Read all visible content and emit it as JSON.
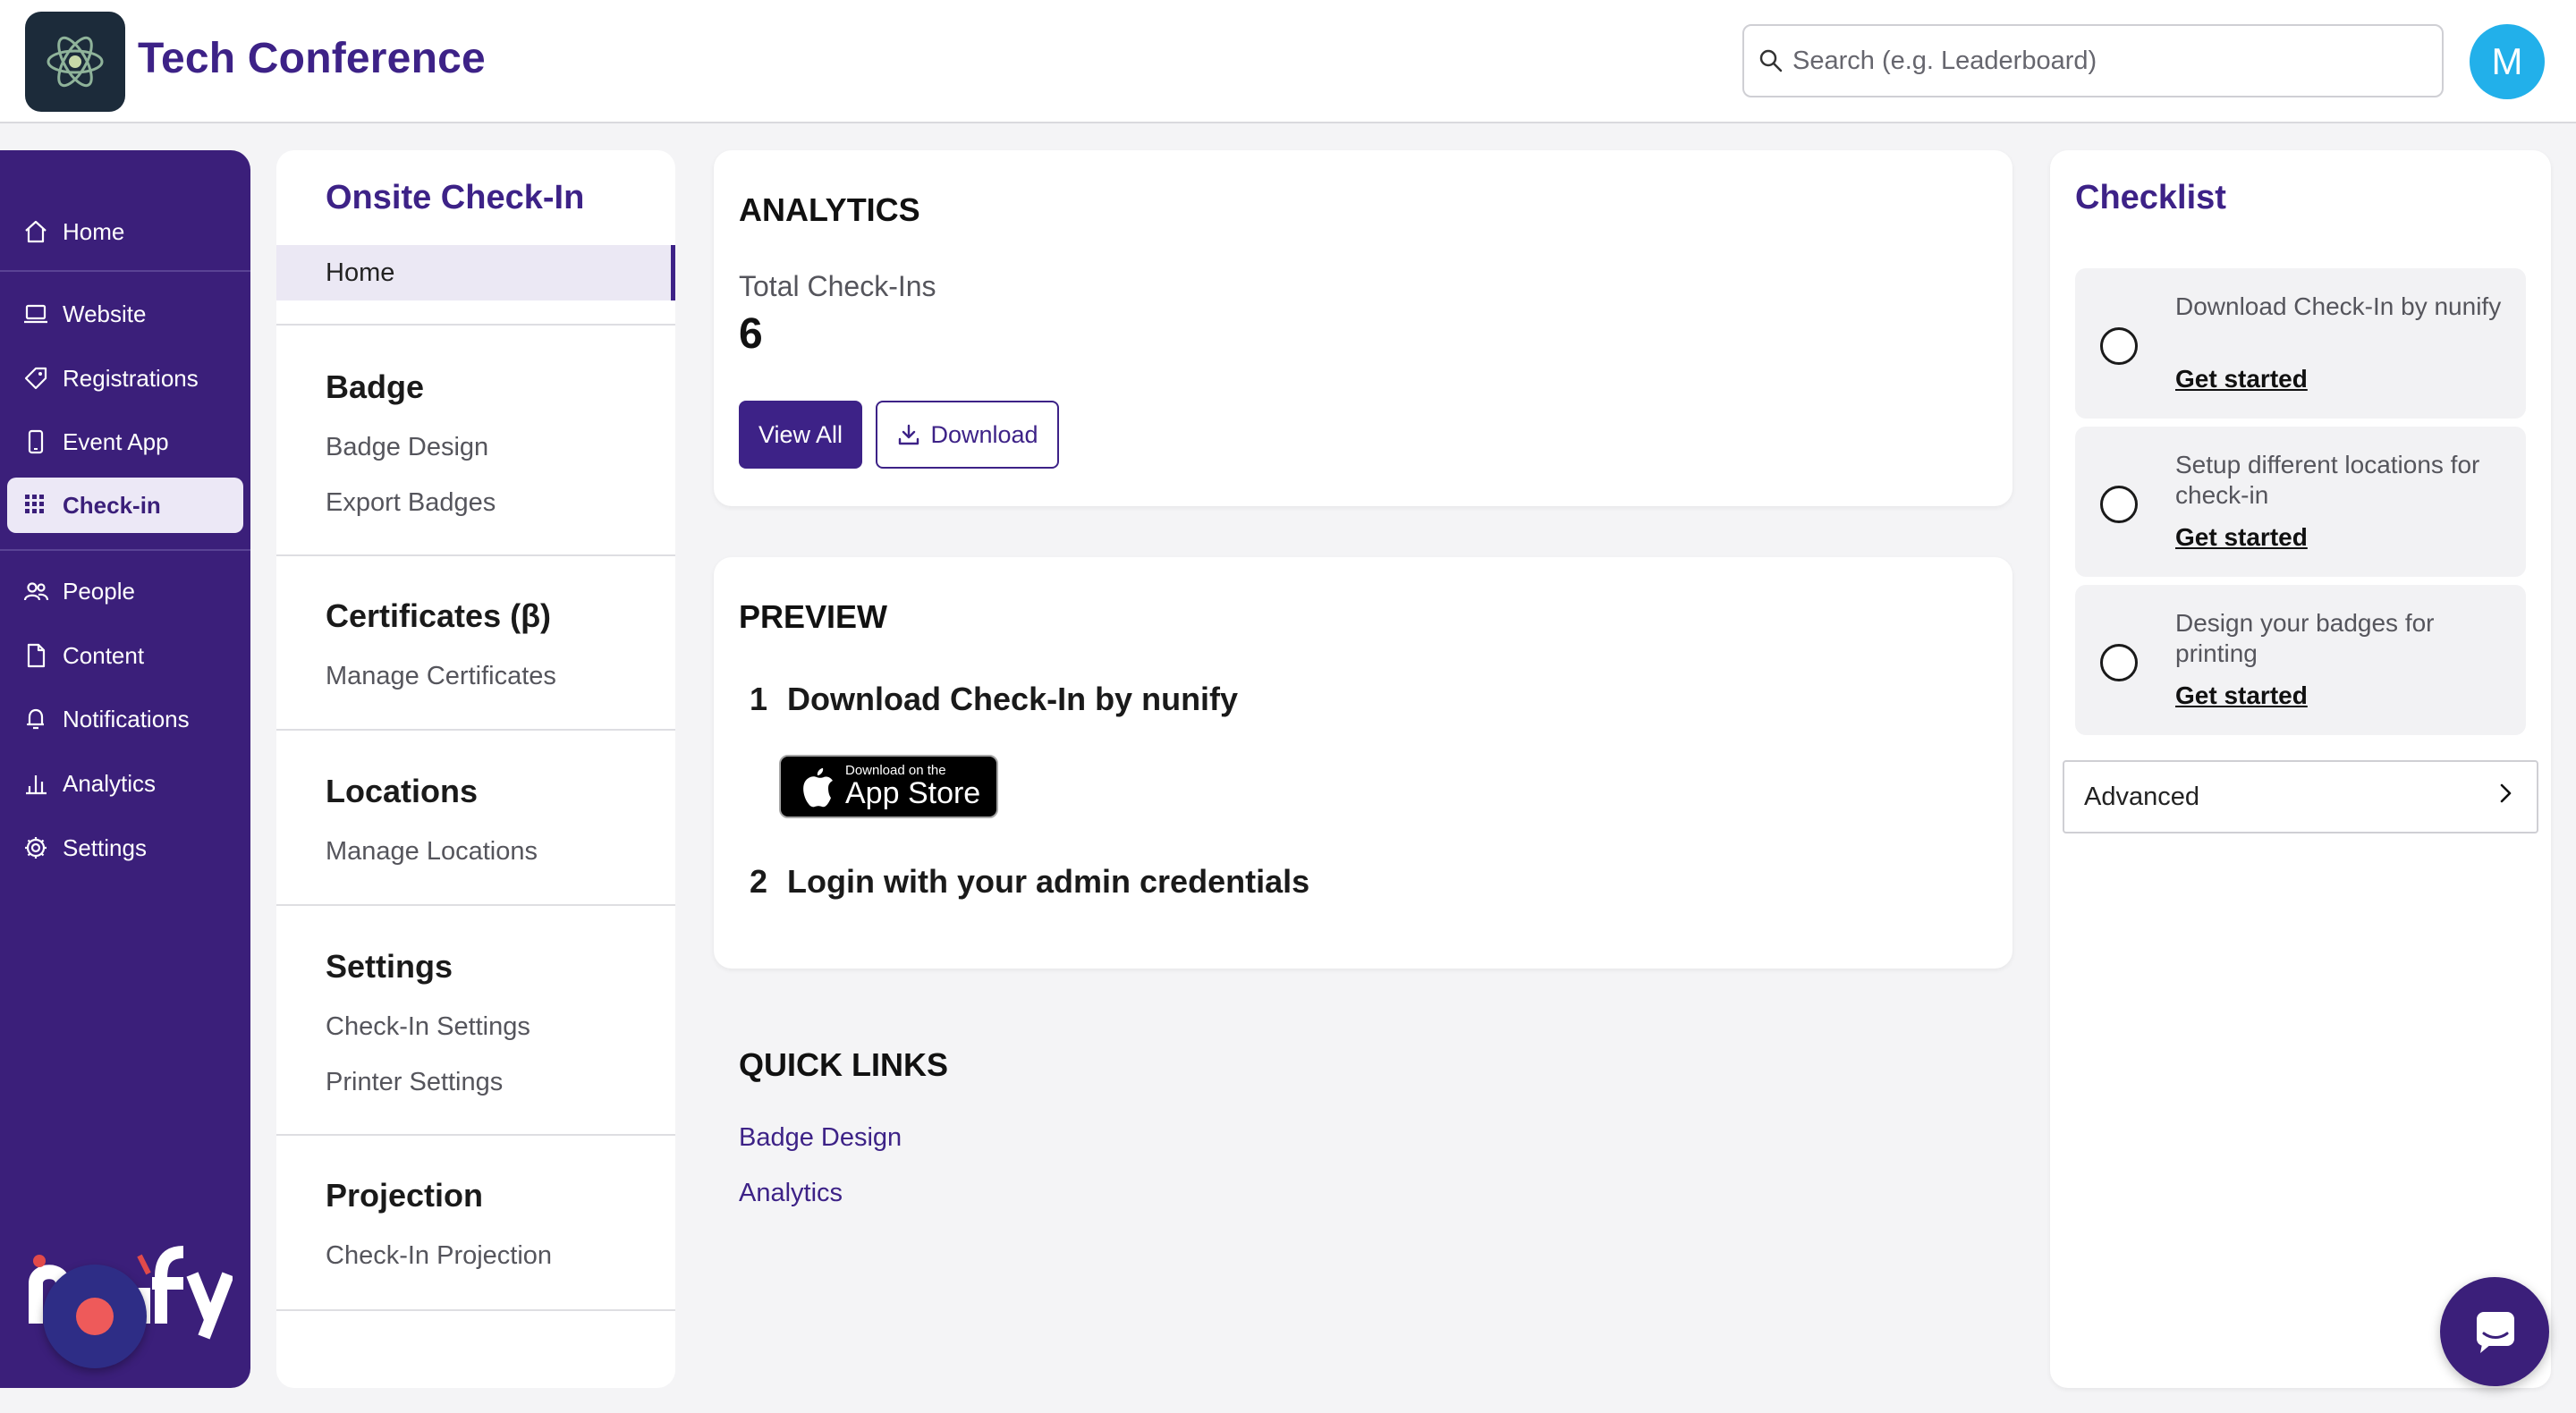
{
  "header": {
    "app_title": "Tech Conference",
    "search_placeholder": "Search (e.g. Leaderboard)",
    "avatar_initial": "M"
  },
  "sidebar": {
    "items": [
      {
        "label": "Home",
        "icon": "home-icon"
      },
      {
        "label": "Website",
        "icon": "laptop-icon"
      },
      {
        "label": "Registrations",
        "icon": "ticket-icon"
      },
      {
        "label": "Event App",
        "icon": "smartphone-icon"
      },
      {
        "label": "Check-in",
        "icon": "qr-grid-icon",
        "active": true
      },
      {
        "label": "People",
        "icon": "people-icon"
      },
      {
        "label": "Content",
        "icon": "document-icon"
      },
      {
        "label": "Notifications",
        "icon": "bell-icon"
      },
      {
        "label": "Analytics",
        "icon": "bar-chart-icon"
      },
      {
        "label": "Settings",
        "icon": "gear-icon"
      }
    ]
  },
  "subnav": {
    "title": "Onsite Check-In",
    "home_label": "Home",
    "sections": [
      {
        "heading": "Badge",
        "links": [
          "Badge Design",
          "Export Badges"
        ]
      },
      {
        "heading": "Certificates (β)",
        "links": [
          "Manage Certificates"
        ]
      },
      {
        "heading": "Locations",
        "links": [
          "Manage Locations"
        ]
      },
      {
        "heading": "Settings",
        "links": [
          "Check-In Settings",
          "Printer Settings"
        ]
      },
      {
        "heading": "Projection",
        "links": [
          "Check-In Projection"
        ]
      }
    ]
  },
  "analytics": {
    "heading": "ANALYTICS",
    "metric_label": "Total Check-Ins",
    "metric_value": "6",
    "view_all_label": "View All",
    "download_label": "Download"
  },
  "preview": {
    "heading": "PREVIEW",
    "step1_number": "1",
    "step1_text": "Download Check-In by nunify",
    "appstore_small": "Download on the",
    "appstore_big": "App Store",
    "step2_number": "2",
    "step2_text": "Login with your admin credentials"
  },
  "quick_links": {
    "heading": "QUICK LINKS",
    "links": [
      "Badge Design",
      "Analytics"
    ]
  },
  "checklist": {
    "title": "Checklist",
    "items": [
      {
        "text": "Download Check-In by nunify",
        "link": "Get started"
      },
      {
        "text": "Setup different locations for check-in",
        "link": "Get started"
      },
      {
        "text": "Design your badges for printing",
        "link": "Get started"
      }
    ],
    "advanced_label": "Advanced"
  },
  "colors": {
    "brand_purple": "#3b1f7a",
    "accent_purple": "#3d2287",
    "avatar_blue": "#22b0ea",
    "record_red": "#ee5a5a"
  }
}
